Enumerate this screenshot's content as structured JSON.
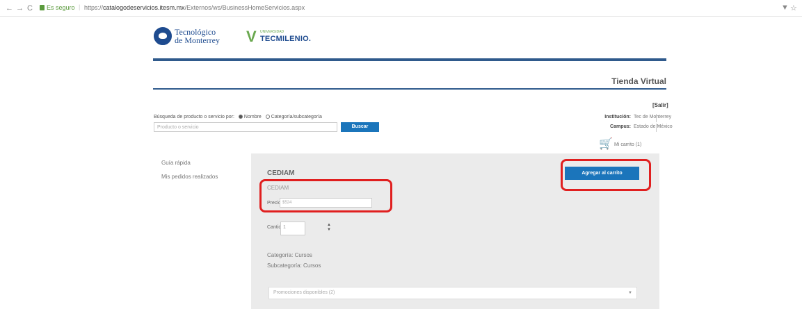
{
  "browser": {
    "back_icon": "←",
    "forward_icon": "→",
    "reload_icon": "C",
    "secure_label": "Es seguro",
    "url_prefix": "https://",
    "url_host": "catalogodeservicios.itesm.mx",
    "url_path": "/Externos/ws/BusinessHomeServicios.aspx",
    "filter_icon": "▼",
    "star_icon": "☆"
  },
  "logos": {
    "tec_line1": "Tecnológico",
    "tec_line2": "de Monterrey",
    "tecmilenio_small": "UNIVERSIDAD",
    "tecmilenio": "TECMILENIO."
  },
  "header": {
    "title": "Tienda Virtual"
  },
  "search": {
    "label": "Búsqueda de producto o servicio por:",
    "option_name": "Nombre",
    "option_category": "Categoría/subcategoría",
    "placeholder": "Producto o servicio",
    "button": "Buscar"
  },
  "account": {
    "salir": "[Salir]",
    "institucion_label": "Institución:",
    "institucion_value": "Tec de Monterrey",
    "campus_label": "Campus:",
    "campus_value": "Estado de México",
    "cart_label": "Mi carrito (1)"
  },
  "menu": {
    "item1": "Guía rápida",
    "item2": "Mis pedidos realizados"
  },
  "product": {
    "title": "CEDIAM",
    "name": "CEDIAM",
    "precio_label": "Precio:",
    "precio_value": "$524",
    "cantidad_label": "Cantidad:",
    "cantidad_value": "1",
    "categoria": "Categoría: Cursos",
    "subcategoria": "Subcategoría: Cursos",
    "promociones": "Promociones disponibles (2)",
    "add_button": "Agregar al carrito"
  },
  "colors": {
    "brand_blue": "#1b75bb",
    "rule_blue": "#2f5a8c",
    "highlight_red": "#e01f1f",
    "panel_gray": "#ebebeb"
  }
}
